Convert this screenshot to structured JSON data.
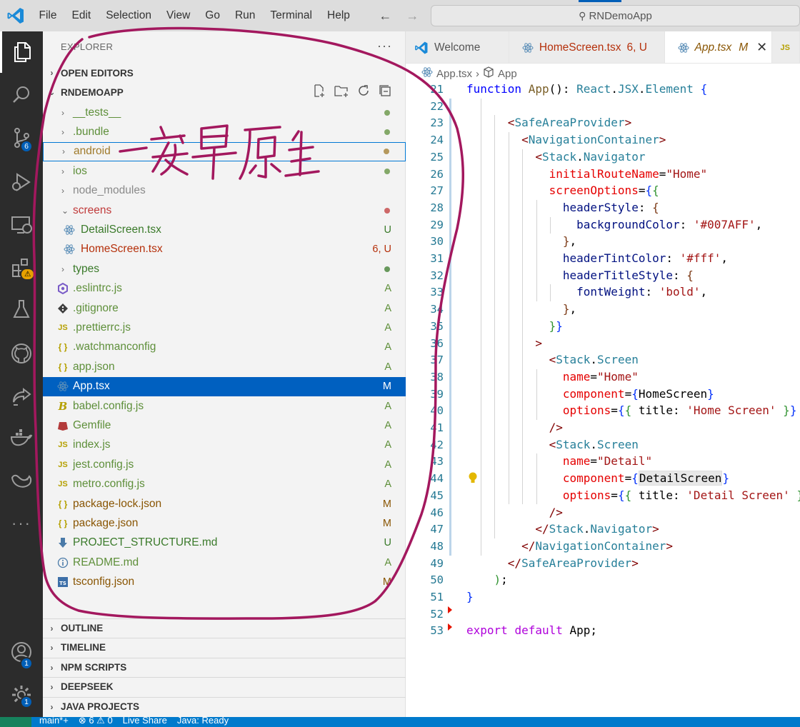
{
  "titlebar": {
    "menu": [
      "File",
      "Edit",
      "Selection",
      "View",
      "Go",
      "Run",
      "Terminal",
      "Help"
    ],
    "search_text": "RNDemoApp"
  },
  "activitybar": {
    "icons": [
      "explorer-icon",
      "search-icon",
      "source-control-icon",
      "run-debug-icon",
      "remote-explorer-icon",
      "extensions-icon",
      "testing-icon",
      "github-icon",
      "live-share-icon",
      "docker-icon",
      "deepseek-icon",
      "more-icon",
      "account-icon",
      "manage-gear-icon"
    ],
    "source_control_badge": "6",
    "account_badge": "1",
    "settings_badge": "1"
  },
  "sidebar": {
    "title": "EXPLORER",
    "more": "···",
    "open_editors": "OPEN EDITORS",
    "project": "RNDEMOAPP",
    "files": [
      {
        "name": "__tests__",
        "type": "folder",
        "status": "dot",
        "color": "#5e8f3a"
      },
      {
        "name": ".bundle",
        "type": "folder",
        "status": "dot",
        "color": "#5e8f3a"
      },
      {
        "name": "android",
        "type": "folder",
        "status": "dot",
        "color": "#a07a2a"
      },
      {
        "name": "ios",
        "type": "folder",
        "status": "dot",
        "color": "#5e8f3a"
      },
      {
        "name": "node_modules",
        "type": "folder",
        "status": "",
        "color": "#8a8a8a"
      },
      {
        "name": "screens",
        "type": "folder-open",
        "status": "dot",
        "color": "#c03a3a"
      },
      {
        "name": "DetailScreen.tsx",
        "type": "react",
        "status": "U",
        "color": "#3a7a2a"
      },
      {
        "name": "HomeScreen.tsx",
        "type": "react",
        "status": "6, U",
        "color": "#b5300b"
      },
      {
        "name": "types",
        "type": "folder",
        "status": "dot",
        "color": "#3a7a2a"
      },
      {
        "name": ".eslintrc.js",
        "type": "eslint",
        "status": "A",
        "color": "#5e8f3a"
      },
      {
        "name": ".gitignore",
        "type": "git",
        "status": "A",
        "color": "#5e8f3a"
      },
      {
        "name": ".prettierrc.js",
        "type": "js",
        "status": "A",
        "color": "#5e8f3a"
      },
      {
        "name": ".watchmanconfig",
        "type": "json",
        "status": "A",
        "color": "#5e8f3a"
      },
      {
        "name": "app.json",
        "type": "json",
        "status": "A",
        "color": "#5e8f3a"
      },
      {
        "name": "App.tsx",
        "type": "react",
        "status": "M",
        "color": "#895503"
      },
      {
        "name": "babel.config.js",
        "type": "babel",
        "status": "A",
        "color": "#5e8f3a"
      },
      {
        "name": "Gemfile",
        "type": "ruby",
        "status": "A",
        "color": "#5e8f3a"
      },
      {
        "name": "index.js",
        "type": "js",
        "status": "A",
        "color": "#5e8f3a"
      },
      {
        "name": "jest.config.js",
        "type": "js",
        "status": "A",
        "color": "#5e8f3a"
      },
      {
        "name": "metro.config.js",
        "type": "js",
        "status": "A",
        "color": "#5e8f3a"
      },
      {
        "name": "package-lock.json",
        "type": "json",
        "status": "M",
        "color": "#895503"
      },
      {
        "name": "package.json",
        "type": "json",
        "status": "M",
        "color": "#895503"
      },
      {
        "name": "PROJECT_STRUCTURE.md",
        "type": "md",
        "status": "U",
        "color": "#3a7a2a"
      },
      {
        "name": "README.md",
        "type": "info",
        "status": "A",
        "color": "#5e8f3a"
      },
      {
        "name": "tsconfig.json",
        "type": "ts",
        "status": "M",
        "color": "#895503"
      }
    ],
    "sections": [
      "OUTLINE",
      "TIMELINE",
      "NPM SCRIPTS",
      "DEEPSEEK",
      "JAVA PROJECTS"
    ]
  },
  "tabs": [
    {
      "label": "Welcome",
      "suffix": "",
      "active": false,
      "color": "#555555"
    },
    {
      "label": "HomeScreen.tsx",
      "suffix": "6, U",
      "active": false,
      "color": "#b5300b"
    },
    {
      "label": "App.tsx",
      "suffix": "M",
      "active": true,
      "color": "#895503"
    },
    {
      "label": "JS",
      "suffix": "",
      "active": false,
      "color": "#b5a000"
    }
  ],
  "breadcrumb": {
    "file": "App.tsx",
    "symbol": "App"
  },
  "editor": {
    "line_numbers": [
      "21",
      "22",
      "23",
      "24",
      "25",
      "26",
      "27",
      "28",
      "29",
      "30",
      "31",
      "32",
      "33",
      "34",
      "35",
      "36",
      "37",
      "38",
      "39",
      "40",
      "41",
      "42",
      "43",
      "44",
      "45",
      "46",
      "47",
      "48",
      "49",
      "50",
      "51",
      "52",
      "53"
    ]
  },
  "statusbar": {
    "branch": "main*+",
    "problems": "⊗ 6 ⚠ 0",
    "live_share": "Live Share",
    "java": "Java: Ready"
  },
  "annotation": {
    "text": "安卓原生",
    "color": "#a3185e"
  }
}
